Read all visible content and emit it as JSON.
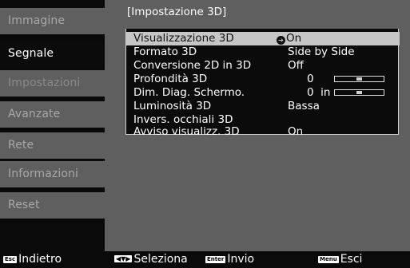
{
  "sidebar": {
    "items": [
      {
        "label": "Immagine",
        "state": "normal"
      },
      {
        "label": "Segnale",
        "state": "active"
      },
      {
        "label": "Impostazioni",
        "state": "dim"
      },
      {
        "label": "Avanzate",
        "state": "normal"
      },
      {
        "label": "Rete",
        "state": "normal"
      },
      {
        "label": "Informazioni",
        "state": "normal"
      },
      {
        "label": "Reset",
        "state": "normal"
      }
    ]
  },
  "main": {
    "title": "[Impostazione 3D]",
    "rows": [
      {
        "label": "Visualizzazione 3D",
        "value": "On",
        "selected": true
      },
      {
        "label": "Formato 3D",
        "value": "Side by Side"
      },
      {
        "label": "Conversione 2D in 3D",
        "value": "Off"
      },
      {
        "label": "Profondità 3D",
        "value": "0",
        "slider_level": 0.5
      },
      {
        "label": "Dim. Diag. Schermo.",
        "value": "0  in",
        "slider_level": 0.5
      },
      {
        "label": "Luminosità 3D",
        "value": "Bassa"
      },
      {
        "label": "Invers. occhiali 3D",
        "value": ""
      },
      {
        "label": "Avviso visualizz. 3D",
        "value": "On"
      }
    ]
  },
  "help_bar": {
    "back": {
      "key": "Esc",
      "label": "Indietro"
    },
    "select": {
      "key": "◀▼▶",
      "label": "Seleziona"
    },
    "enter": {
      "key": "Enter",
      "label": "Invio"
    },
    "exit": {
      "key": "Menu",
      "label": "Esci"
    }
  }
}
